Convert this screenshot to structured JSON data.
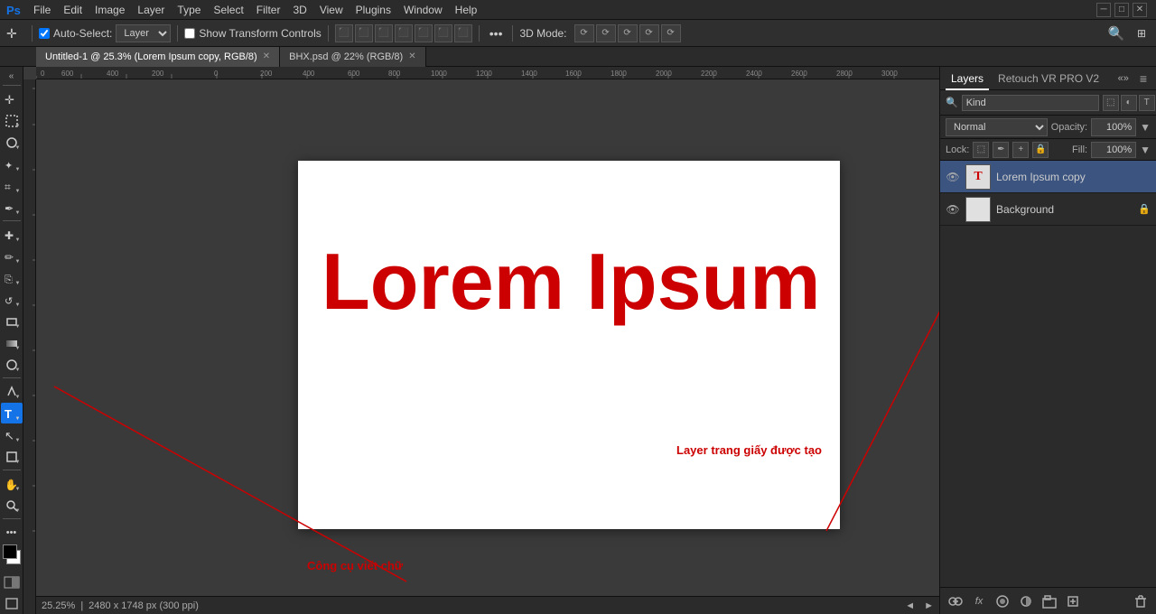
{
  "app": {
    "title": "Adobe Photoshop"
  },
  "menubar": {
    "items": [
      "Ps",
      "File",
      "Edit",
      "Image",
      "Layer",
      "Type",
      "Select",
      "Filter",
      "3D",
      "View",
      "Plugins",
      "Window",
      "Help"
    ]
  },
  "optionsbar": {
    "tool_icon": "↖",
    "auto_select_label": "Auto-Select:",
    "auto_select_checked": true,
    "layer_dropdown": "Layer",
    "show_transform": "Show Transform Controls",
    "align_btns": [
      "⬛",
      "⬛",
      "⬛",
      "⬛",
      "⬛",
      "⬛",
      "⬛"
    ],
    "more_label": "•••",
    "3d_label": "3D Mode:",
    "search_icon": "🔍",
    "settings_icon": "⚙"
  },
  "tabbar": {
    "tabs": [
      {
        "label": "Untitled-1 @ 25.3% (Lorem Ipsum copy, RGB/8)",
        "active": true,
        "modified": true
      },
      {
        "label": "BHX.psd @ 22% (RGB/8)",
        "active": false,
        "modified": true
      }
    ]
  },
  "toolbar": {
    "tools": [
      {
        "name": "move",
        "icon": "✛",
        "active": false
      },
      {
        "name": "marquee",
        "icon": "⬚",
        "active": false
      },
      {
        "name": "lasso",
        "icon": "⌾",
        "active": false
      },
      {
        "name": "magic-wand",
        "icon": "✦",
        "active": false
      },
      {
        "name": "crop",
        "icon": "⌗",
        "active": false
      },
      {
        "name": "eyedropper",
        "icon": "✒",
        "active": false
      },
      {
        "name": "healing",
        "icon": "✚",
        "active": false
      },
      {
        "name": "brush",
        "icon": "✏",
        "active": false
      },
      {
        "name": "stamp",
        "icon": "⎘",
        "active": false
      },
      {
        "name": "eraser",
        "icon": "◻",
        "active": false
      },
      {
        "name": "gradient",
        "icon": "▦",
        "active": false
      },
      {
        "name": "blur",
        "icon": "◌",
        "active": false
      },
      {
        "name": "dodge",
        "icon": "◯",
        "active": false
      },
      {
        "name": "pen",
        "icon": "✒",
        "active": false
      },
      {
        "name": "type",
        "icon": "T",
        "active": true
      },
      {
        "name": "path-selection",
        "icon": "↖",
        "active": false
      },
      {
        "name": "shape",
        "icon": "□",
        "active": false
      },
      {
        "name": "hand",
        "icon": "✋",
        "active": false
      },
      {
        "name": "zoom",
        "icon": "🔍",
        "active": false
      }
    ]
  },
  "canvas": {
    "document_title": "Lorem Ipsum",
    "document_subtitle": "Layer trang giấy được tạo",
    "annotation_label": "Công cụ viết chữ",
    "zoom_level": "25.25%",
    "dimensions": "2480 x 1748 px (300 ppi)"
  },
  "layers_panel": {
    "title": "Layers",
    "panel2_title": "Retouch VR PRO V2",
    "search_placeholder": "Kind",
    "blend_mode": "Normal",
    "opacity_label": "Opacity:",
    "opacity_value": "100%",
    "lock_label": "Lock:",
    "fill_label": "Fill:",
    "fill_value": "100%",
    "layers": [
      {
        "name": "Lorem Ipsum copy",
        "type": "text",
        "visible": true,
        "selected": true,
        "locked": false
      },
      {
        "name": "Background",
        "type": "image",
        "visible": true,
        "selected": false,
        "locked": true
      }
    ],
    "bottom_icons": [
      "🔗",
      "fx",
      "□",
      "◑",
      "📁",
      "🗑"
    ]
  }
}
